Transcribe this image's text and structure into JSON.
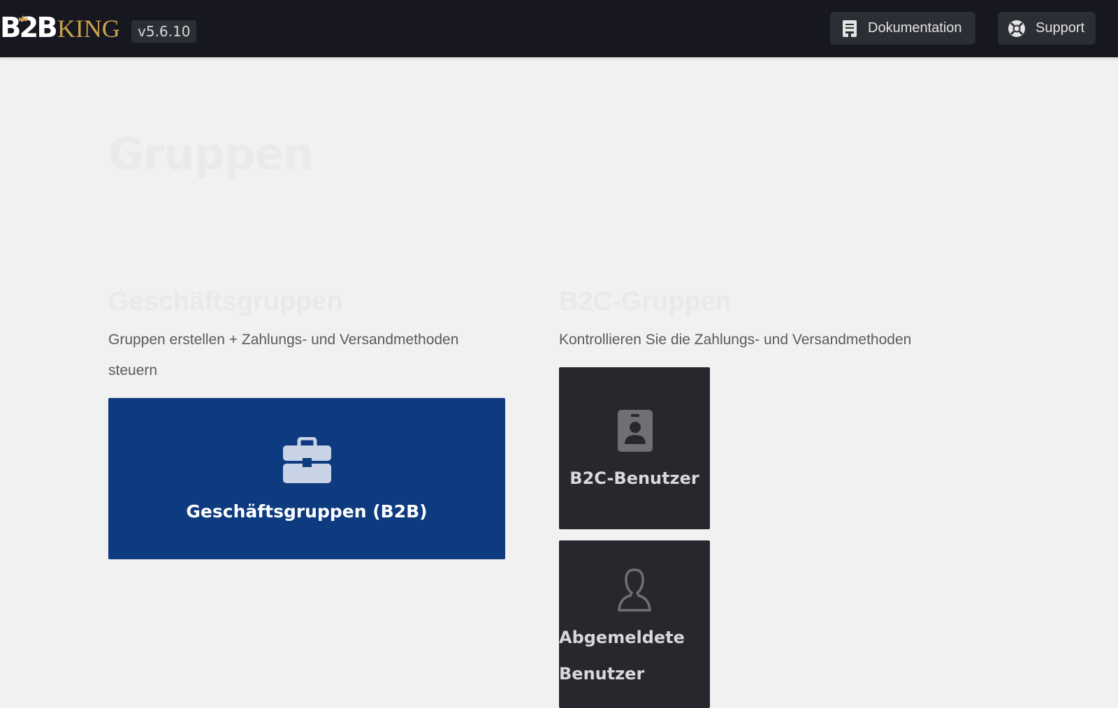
{
  "header": {
    "logo_text_b2b": "B2B",
    "logo_text_king": "KING",
    "version": "v5.6.10",
    "buttons": {
      "documentation": "Dokumentation",
      "support": "Support"
    }
  },
  "page": {
    "title": "Gruppen"
  },
  "business_groups": {
    "title": "Geschäftsgruppen",
    "description": "Gruppen erstellen + Zahlungs- und Versandmethoden steuern",
    "card_label": "Geschäftsgruppen (B2B)",
    "card_icon": "briefcase-icon"
  },
  "b2c_groups": {
    "title": "B2C-Gruppen",
    "description": "Kontrollieren Sie die Zahlungs- und Versandmethoden",
    "cards": [
      {
        "label": "B2C-Benutzer",
        "icon": "id-badge-icon"
      },
      {
        "label": "Abgemeldete Benutzer",
        "icon": "user-outline-icon"
      }
    ]
  },
  "colors": {
    "topbar": "#161720",
    "accent_blue": "#0e3a80",
    "logo_gold": "#c9a24b",
    "dark_card": "#27282d",
    "background": "#f1f1f1"
  }
}
